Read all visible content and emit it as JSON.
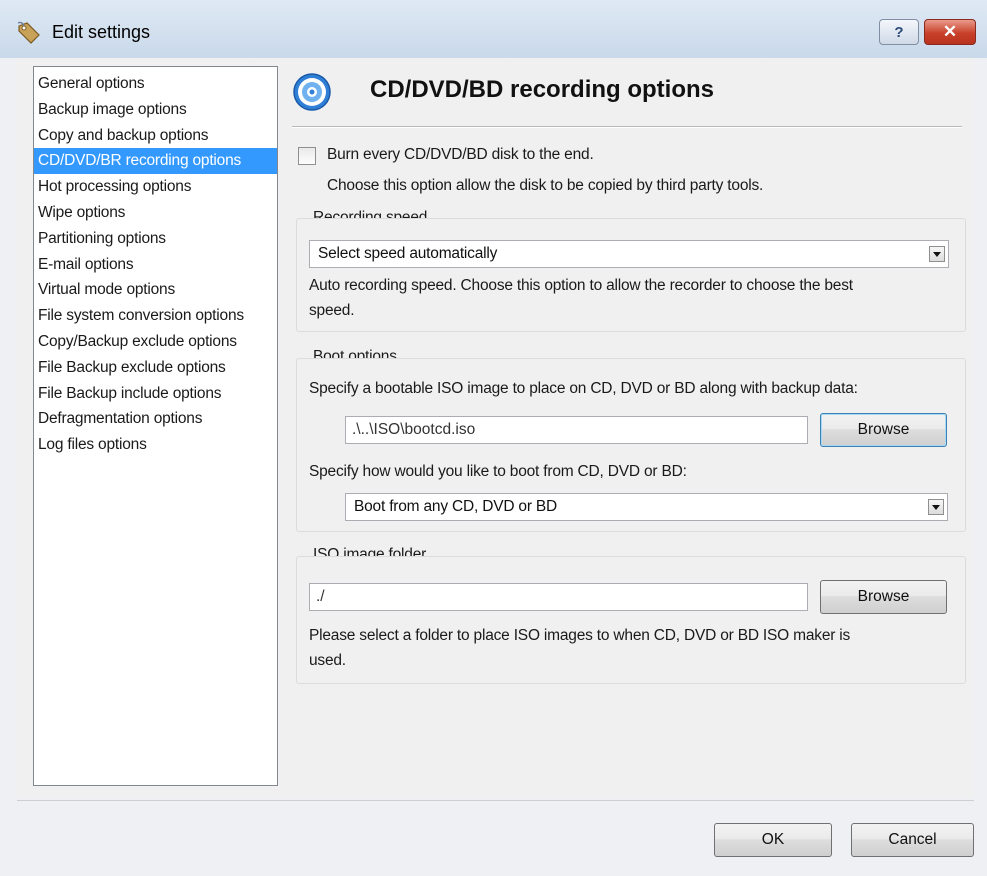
{
  "window": {
    "title": "Edit settings",
    "help_label": "?",
    "close_label": "✕",
    "icon": "settings-tag-icon"
  },
  "nav": {
    "items": [
      {
        "label": "General options",
        "selected": false
      },
      {
        "label": "Backup image options",
        "selected": false
      },
      {
        "label": "Copy and backup options",
        "selected": false
      },
      {
        "label": "CD/DVD/BR recording options",
        "selected": true
      },
      {
        "label": "Hot processing options",
        "selected": false
      },
      {
        "label": "Wipe options",
        "selected": false
      },
      {
        "label": "Partitioning options",
        "selected": false
      },
      {
        "label": "E-mail options",
        "selected": false
      },
      {
        "label": "Virtual mode options",
        "selected": false
      },
      {
        "label": "File system conversion options",
        "selected": false
      },
      {
        "label": "Copy/Backup exclude options",
        "selected": false
      },
      {
        "label": "File Backup exclude options",
        "selected": false
      },
      {
        "label": "File Backup include options",
        "selected": false
      },
      {
        "label": "Defragmentation options",
        "selected": false
      },
      {
        "label": "Log files options",
        "selected": false
      }
    ]
  },
  "panel": {
    "title": "CD/DVD/BD recording options",
    "icon": "disc-icon",
    "burn": {
      "checked": false,
      "label": "Burn every CD/DVD/BD disk to the end.",
      "description": "Choose this option allow the disk to be copied by third party tools."
    },
    "speed": {
      "heading": "Recording speed",
      "selected": "Select speed automatically",
      "description_line1": "Auto recording speed. Choose this option to allow the recorder to choose the best",
      "description_line2": "speed."
    },
    "boot": {
      "heading": "Boot options",
      "iso_prompt": "Specify a bootable ISO image to place on CD, DVD or BD along with backup data:",
      "iso_path": ".\\..\\ISO\\bootcd.iso",
      "browse_label": "Browse",
      "boot_prompt": "Specify how would you like to boot from CD, DVD or BD:",
      "boot_selected": "Boot from any CD, DVD or BD"
    },
    "iso_folder": {
      "heading": "ISO image folder",
      "path": "./",
      "browse_label": "Browse",
      "description_line1": "Please select a folder to place ISO images to when CD, DVD or BD ISO maker is",
      "description_line2": "used."
    }
  },
  "footer": {
    "ok_label": "OK",
    "cancel_label": "Cancel"
  },
  "colors": {
    "selection": "#3399ff",
    "close_button": "#c8412a",
    "titlebar": "#c9d9ea"
  }
}
